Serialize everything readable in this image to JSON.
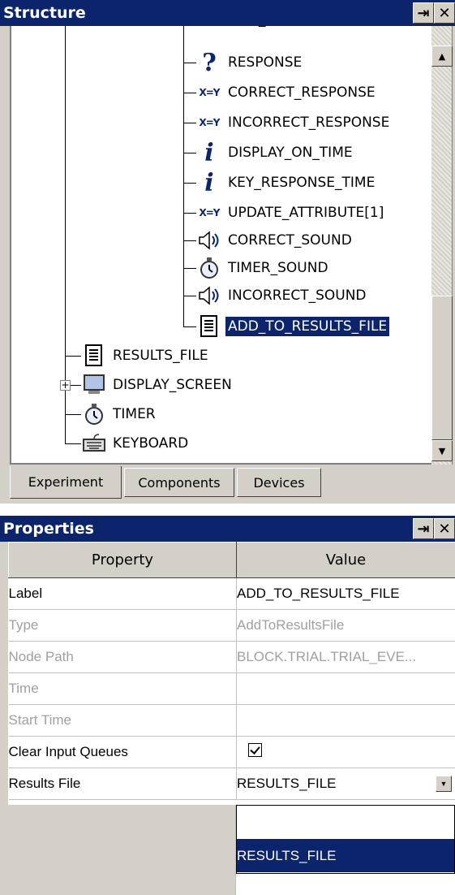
{
  "structure_panel": {
    "title": "Structure",
    "pin_icon": "⇥",
    "close_icon": "✕",
    "tree_items": [
      {
        "label": "RESPONSE",
        "icon": "response-icon"
      },
      {
        "label": "CORRECT_RESPONSE",
        "icon": "update-attribute-icon"
      },
      {
        "label": "INCORRECT_RESPONSE",
        "icon": "update-attribute-icon"
      },
      {
        "label": "DISPLAY_ON_TIME",
        "icon": "info-icon"
      },
      {
        "label": "KEY_RESPONSE_TIME",
        "icon": "info-icon"
      },
      {
        "label": "UPDATE_ATTRIBUTE[1]",
        "icon": "update-attribute-icon"
      },
      {
        "label": "CORRECT_SOUND",
        "icon": "sound-icon"
      },
      {
        "label": "TIMER_SOUND",
        "icon": "timer-icon"
      },
      {
        "label": "INCORRECT_SOUND",
        "icon": "sound-icon"
      },
      {
        "label": "ADD_TO_RESULTS_FILE",
        "icon": "results-file-icon",
        "selected": true
      },
      {
        "label": "RESULTS_FILE",
        "icon": "results-file-icon"
      },
      {
        "label": "DISPLAY_SCREEN",
        "icon": "display-screen-icon"
      },
      {
        "label": "TIMER",
        "icon": "timer-icon"
      },
      {
        "label": "KEYBOARD",
        "icon": "keyboard-icon"
      }
    ],
    "expander_label": "+"
  },
  "tabs": [
    {
      "label": "Experiment",
      "active": true
    },
    {
      "label": "Components",
      "active": false
    },
    {
      "label": "Devices",
      "active": false
    }
  ],
  "properties_panel": {
    "title": "Properties",
    "pin_icon": "⇥",
    "close_icon": "✕",
    "columns": {
      "property": "Property",
      "value": "Value"
    },
    "rows": [
      {
        "property": "Label",
        "value": "ADD_TO_RESULTS_FILE",
        "readonly": false
      },
      {
        "property": "Type",
        "value": "AddToResultsFile",
        "readonly": true
      },
      {
        "property": "Node Path",
        "value": "BLOCK.TRIAL.TRIAL_EVE...",
        "readonly": true
      },
      {
        "property": "Time",
        "value": "",
        "readonly": true
      },
      {
        "property": "Start Time",
        "value": "",
        "readonly": true
      },
      {
        "property": "Clear Input Queues",
        "value": "",
        "checked": true,
        "readonly": false
      },
      {
        "property": "Results File",
        "value": "RESULTS_FILE",
        "readonly": false
      }
    ],
    "dropdown_options": [
      "",
      "RESULTS_FILE"
    ],
    "dropdown_selected": "RESULTS_FILE"
  },
  "colors": {
    "title_bar": "#0b246b",
    "selection": "#0b246b",
    "chrome": "#d4d0c8",
    "icon_blue": "#0b246b"
  }
}
